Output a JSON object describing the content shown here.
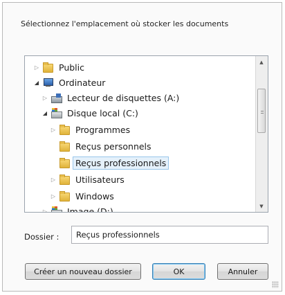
{
  "dialog": {
    "prompt": "Sélectionnez l'emplacement où stocker les documents"
  },
  "tree": {
    "items": [
      {
        "label": "Public",
        "icon": "folder-icon",
        "expander": "collapsed"
      },
      {
        "label": "Ordinateur",
        "icon": "computer-icon",
        "expander": "expanded"
      },
      {
        "label": "Lecteur de disquettes (A:)",
        "icon": "floppy-drive-icon",
        "expander": "collapsed"
      },
      {
        "label": "Disque local (C:)",
        "icon": "local-disk-icon",
        "expander": "expanded"
      },
      {
        "label": "Programmes",
        "icon": "folder-icon",
        "expander": "collapsed"
      },
      {
        "label": "Reçus personnels",
        "icon": "folder-icon",
        "expander": "none"
      },
      {
        "label": "Reçus professionnels",
        "icon": "folder-icon",
        "expander": "none",
        "selected": true
      },
      {
        "label": "Utilisateurs",
        "icon": "folder-icon",
        "expander": "collapsed"
      },
      {
        "label": "Windows",
        "icon": "folder-icon",
        "expander": "collapsed"
      },
      {
        "label": "Image (D:)",
        "icon": "drive-icon",
        "expander": "collapsed"
      }
    ]
  },
  "folder_field": {
    "label": "Dossier :",
    "value": "Reçus professionnels"
  },
  "buttons": {
    "new_folder": "Créer un nouveau dossier",
    "ok": "OK",
    "cancel": "Annuler"
  },
  "colors": {
    "selection": "#e5f1fb",
    "selection_border": "#98c5ea",
    "default_button_border": "#3c7fb1"
  }
}
